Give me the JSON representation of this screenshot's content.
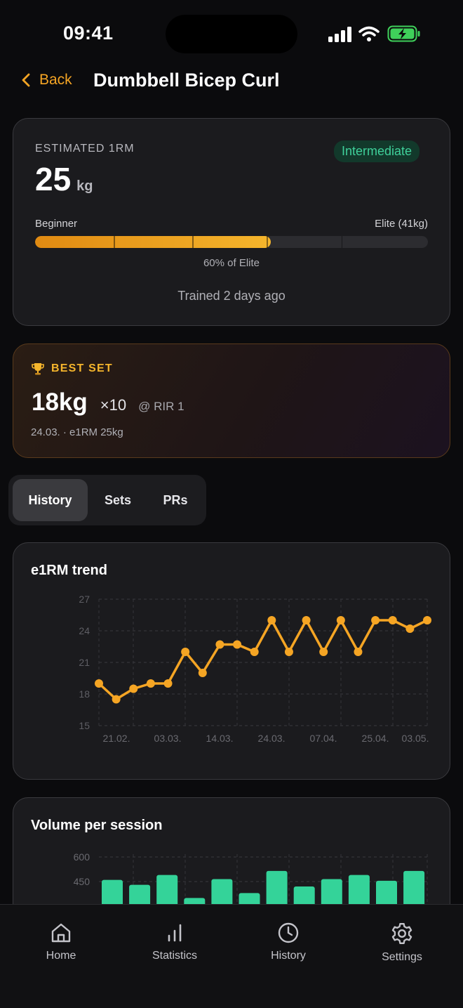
{
  "status_bar": {
    "time": "09:41"
  },
  "nav": {
    "back_label": "Back",
    "title": "Dumbbell Bicep Curl"
  },
  "estimated": {
    "label": "ESTIMATED 1RM",
    "value": "25",
    "unit": "kg",
    "level_badge": "Intermediate",
    "scale_start": "Beginner",
    "scale_end": "Elite (41kg)",
    "progress_fraction": 0.6,
    "progress_text": "60% of Elite",
    "last_trained": "Trained 2 days ago",
    "accent": "#f5a524",
    "badge_color": "#3fd09a"
  },
  "best_set": {
    "icon": "trophy-icon",
    "label": "BEST SET",
    "weight": "18kg",
    "reps": "×10",
    "rir": "@ RIR 1",
    "meta": "24.03. · e1RM 25kg"
  },
  "tabs": [
    {
      "label": "History",
      "active": true
    },
    {
      "label": "Sets",
      "active": false
    },
    {
      "label": "PRs",
      "active": false
    }
  ],
  "chart_data": [
    {
      "type": "line",
      "title": "e1RM trend",
      "color": "#f5a524",
      "yticks": [
        "27",
        "24",
        "21",
        "18",
        "15"
      ],
      "ylim": [
        15,
        27
      ],
      "xticks": [
        "21.02.",
        "03.03.",
        "14.03.",
        "24.03.",
        "07.04.",
        "25.04.",
        "03.05."
      ],
      "values": [
        19.0,
        17.5,
        18.5,
        19.0,
        19.0,
        22.0,
        20.0,
        22.7,
        22.7,
        22.0,
        25.0,
        22.0,
        25.0,
        22.0,
        25.0,
        22.0,
        25.0,
        25.0,
        24.2,
        25.0
      ],
      "grid": true
    },
    {
      "type": "bar",
      "title": "Volume per session",
      "color": "#34d399",
      "yticks": [
        "600",
        "450"
      ],
      "ylim": [
        0,
        600
      ],
      "values": [
        460,
        430,
        490,
        350,
        465,
        380,
        515,
        420,
        465,
        490,
        455,
        515
      ],
      "grid": true
    }
  ],
  "bottom_nav": [
    {
      "label": "Home",
      "icon": "home-icon"
    },
    {
      "label": "Statistics",
      "icon": "bar-chart-icon"
    },
    {
      "label": "History",
      "icon": "clock-icon"
    },
    {
      "label": "Settings",
      "icon": "gear-icon"
    }
  ]
}
